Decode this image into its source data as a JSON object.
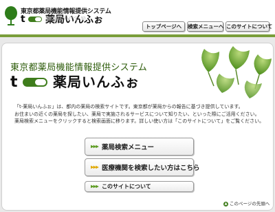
{
  "header": {
    "system_name": "東京都薬局機能情報提供システム",
    "brand_name": "薬局いんふぉ",
    "brand_reflection": "薬局いんふぉ",
    "nav": [
      {
        "label": "トップページへ"
      },
      {
        "label": "検索メニューへ"
      },
      {
        "label": "このサイトについて"
      }
    ]
  },
  "main": {
    "system_name": "東京都薬局機能情報提供システム",
    "brand_name": "薬局いんふぉ",
    "description": [
      "「t-薬局いんふぉ」は、都内の薬局の検索サイトです。東京都が薬局からの報告に基づき提供しています。",
      "お住まいの近くの薬局を探したい、薬局で実施されるサービスについて知りたい、といった際にご活用ください。",
      "薬局検索メニューをクリックすると検索画面に移ります。詳しい使い方は「このサイトについて」をご覧ください。"
    ],
    "buttons": [
      {
        "label": "薬局検索メニュー",
        "arrow_color": "#5a9a1e"
      },
      {
        "label": "医療機関を検索したい方はこちら",
        "arrow_color": "#e0a800"
      },
      {
        "label": "このサイトについて",
        "arrow_color": "#5a9a1e"
      }
    ],
    "page_top": "このページの先頭へ"
  },
  "colors": {
    "brand_green": "#3f7d1c",
    "header_rule": "#7a9e3a",
    "title_green": "#2f5d0c"
  }
}
